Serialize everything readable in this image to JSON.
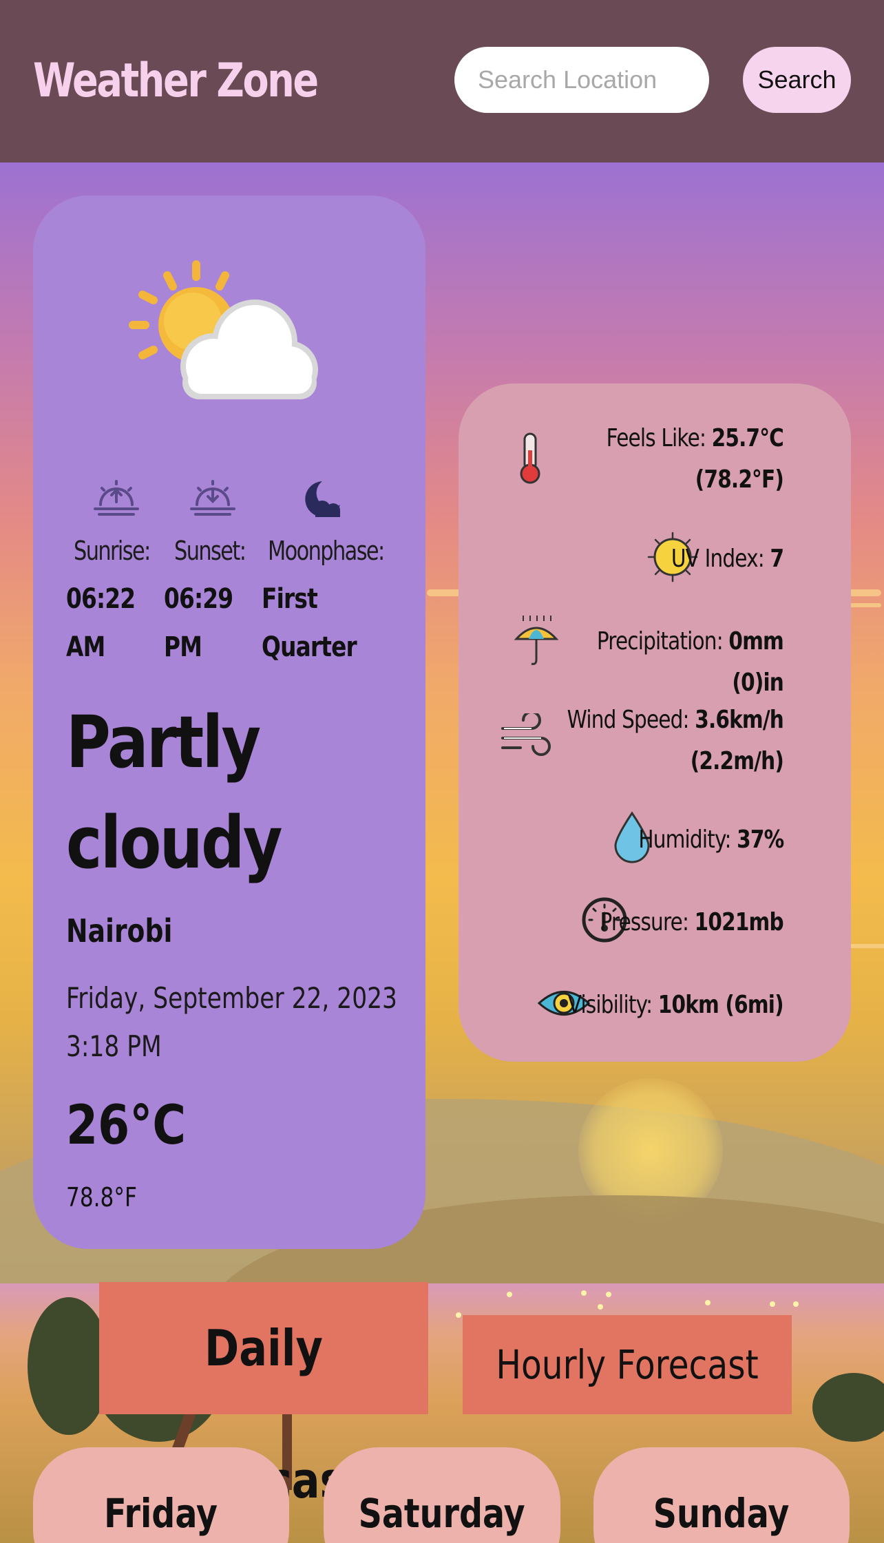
{
  "header": {
    "title": "Weather Zone",
    "search_placeholder": "Search Location",
    "search_button": "Search"
  },
  "current": {
    "condition": "Partly cloudy",
    "condition_icon": "partly-cloudy-icon",
    "city": "Nairobi",
    "date": "Friday, September 22, 2023",
    "time": "3:18 PM",
    "temp_c": "26°C",
    "temp_f": "78.8°F"
  },
  "astro": {
    "sunrise_label": "Sunrise:",
    "sunrise_value": "06:22\nAM",
    "sunset_label": "Sunset:",
    "sunset_value": "06:29\nPM",
    "moonphase_label": "Moonphase:",
    "moonphase_value": "First\nQuarter"
  },
  "details": [
    {
      "icon": "thermometer-icon",
      "label": "Feels Like:",
      "value": "25.7°C (78.2°F)"
    },
    {
      "icon": "sun-icon",
      "label": "UV Index:",
      "value": "7"
    },
    {
      "icon": "umbrella-icon",
      "label": "Precipitation:",
      "value": "0mm (0)in"
    },
    {
      "icon": "wind-icon",
      "label": "Wind Speed:",
      "value": "3.6km/h (2.2m/h)"
    },
    {
      "icon": "droplet-icon",
      "label": "Humidity:",
      "value": "37%"
    },
    {
      "icon": "gauge-icon",
      "label": "Pressure:",
      "value": "1021mb"
    },
    {
      "icon": "eye-icon",
      "label": "Visibility:",
      "value": "10km (6mi)"
    }
  ],
  "forecast_tabs": {
    "daily": "Daily Forecast",
    "hourly": "Hourly Forecast"
  },
  "days": [
    "Friday",
    "Saturday",
    "Sunday"
  ],
  "colors": {
    "header_bg": "#6a4a55",
    "title": "#f7d1ec",
    "main_card": "#a985d7",
    "details_card": "#d79faf",
    "tab": "#e27561",
    "day_card": "#edb2ac"
  }
}
